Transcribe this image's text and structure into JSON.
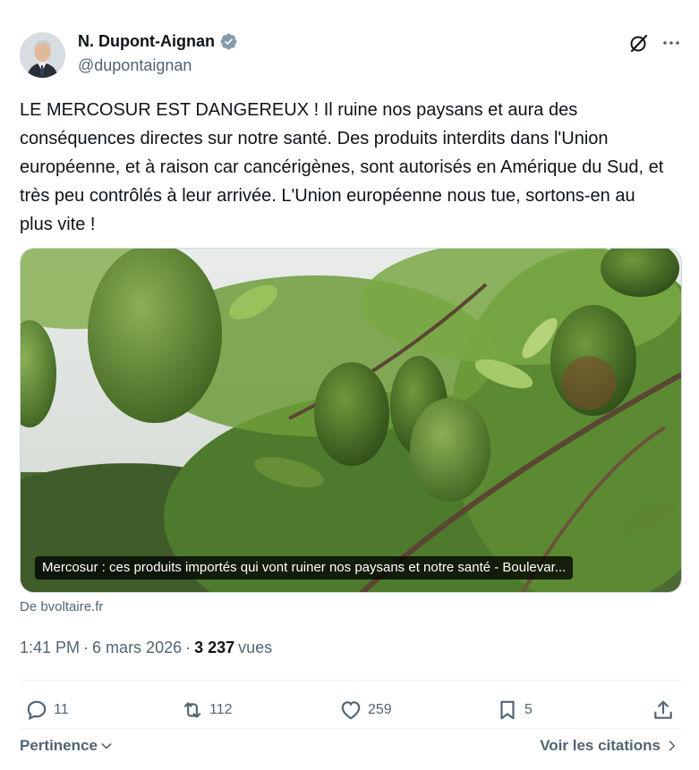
{
  "author": {
    "name": "N. Dupont-Aignan",
    "handle": "@dupontaignan"
  },
  "tweet": {
    "text": "LE MERCOSUR EST DANGEREUX ! Il ruine nos paysans et aura des conséquences directes sur notre santé. Des produits interdits dans l'Union européenne, et à raison car cancérigènes, sont autorisés en Amérique du Sud, et très peu contrôlés à leur arrivée. L'Union européenne nous tue, sortons-en au plus vite !"
  },
  "card": {
    "title": "Mercosur : ces produits importés qui vont ruiner nos paysans et notre santé - Boulevar...",
    "source": "De bvoltaire.fr"
  },
  "meta": {
    "time": "1:41 PM",
    "separator1": "·",
    "date": "6 mars 2026",
    "separator2": "·",
    "views": "3 237",
    "views_label": "vues"
  },
  "actions": {
    "replies": "11",
    "reposts": "112",
    "likes": "259",
    "bookmarks": "5"
  },
  "footer": {
    "sort_label": "Pertinence",
    "quotes_label": "Voir les citations"
  },
  "colors": {
    "text_primary": "#0f1419",
    "text_secondary": "#536471",
    "verified": "#829aab",
    "divider": "#eff3f4"
  },
  "icons": {
    "verified": "verified-badge-icon",
    "grok": "grok-icon",
    "more": "more-horizontal-icon",
    "reply": "reply-icon",
    "repost": "repost-icon",
    "like": "heart-icon",
    "bookmark": "bookmark-icon",
    "share": "share-icon",
    "chevron": "chevron-down-icon",
    "arrow": "chevron-right-icon"
  }
}
